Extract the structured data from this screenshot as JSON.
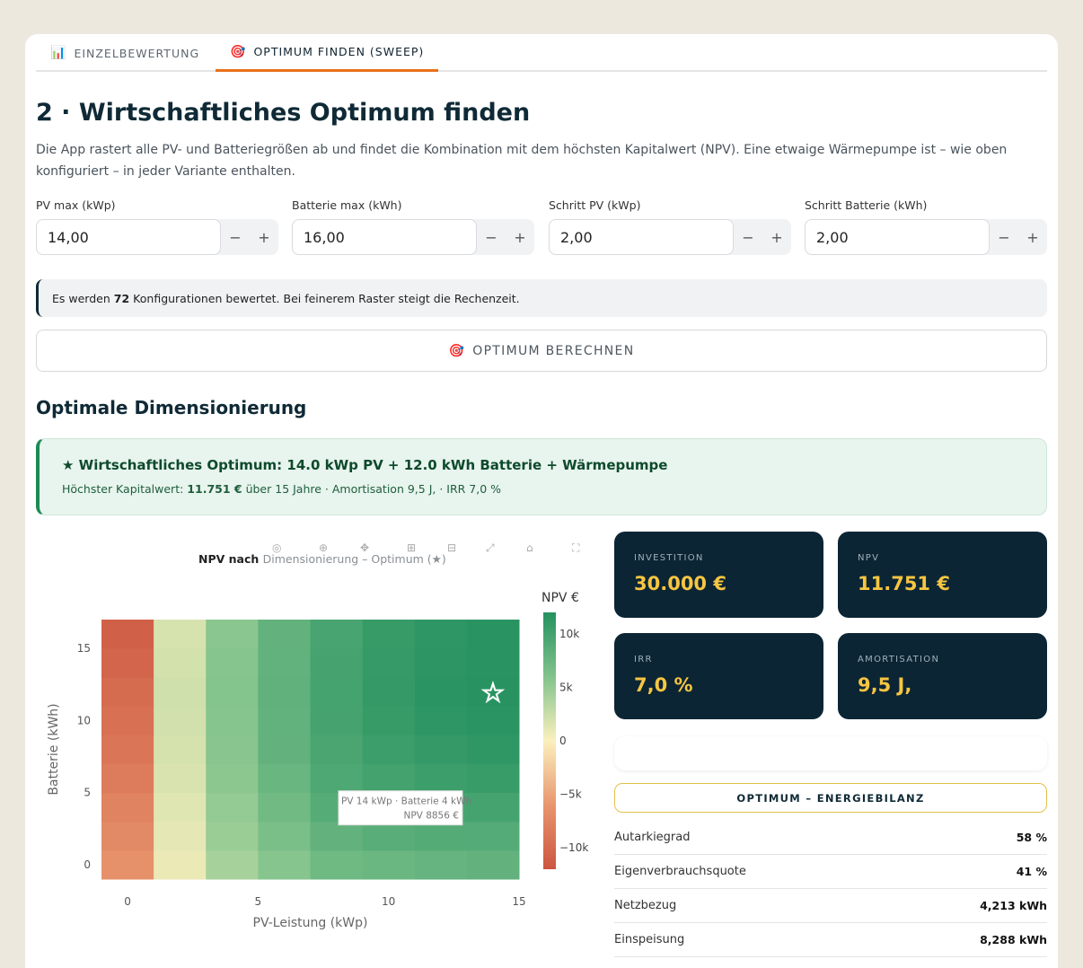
{
  "tabs": [
    {
      "label": "EINZELBEWERTUNG",
      "icon": "📊"
    },
    {
      "label": "OPTIMUM FINDEN (SWEEP)",
      "icon": "🎯"
    }
  ],
  "heading": "2 · Wirtschaftliches Optimum finden",
  "description": "Die App rastert alle PV- und Batteriegrößen ab und findet die Kombination mit dem höchsten Kapitalwert (NPV). Eine etwaige Wärmepumpe ist – wie oben konfiguriert – in jeder Variante enthalten.",
  "inputs": [
    {
      "label": "PV max (kWp)",
      "value": "14,00"
    },
    {
      "label": "Batterie max (kWh)",
      "value": "16,00"
    },
    {
      "label": "Schritt PV (kWp)",
      "value": "2,00"
    },
    {
      "label": "Schritt Batterie (kWh)",
      "value": "2,00"
    }
  ],
  "stepper": {
    "minus": "−",
    "plus": "+"
  },
  "info": {
    "pre": "Es werden",
    "count": "72",
    "post": "Konfigurationen bewertet. Bei feinerem Raster steigt die Rechenzeit."
  },
  "calc_button": {
    "label": "OPTIMUM BERECHNEN",
    "icon": "🎯"
  },
  "section_title": "Optimale Dimensionierung",
  "success": {
    "title": "★ Wirtschaftliches Optimum: 14.0 kWp PV + 12.0 kWh Batterie + Wärmepumpe",
    "sub_pre": "Höchster Kapitalwert:",
    "sub_value": "11.751 €",
    "sub_post": "über 15 Jahre · Amortisation 9,5 J, · IRR 7,0 %"
  },
  "kpis": [
    {
      "label": "INVESTITION",
      "value": "30.000 €"
    },
    {
      "label": "NPV",
      "value": "11.751 €"
    },
    {
      "label": "IRR",
      "value": "7,0 %"
    },
    {
      "label": "AMORTISATION",
      "value": "9,5 J,"
    }
  ],
  "energy_title": "OPTIMUM – ENERGIEBILANZ",
  "energy_rows": [
    {
      "label": "Autarkiegrad",
      "value": "58 %"
    },
    {
      "label": "Eigenverbrauchsquote",
      "value": "41 %"
    },
    {
      "label": "Netzbezug",
      "value": "4,213 kWh"
    },
    {
      "label": "Einspeisung",
      "value": "8,288 kWh"
    }
  ],
  "chart_data": {
    "type": "heatmap",
    "title_bold": "NPV nach",
    "title_rest": "Dimensionierung – Optimum (★)",
    "xlabel": "PV-Leistung (kWp)",
    "ylabel": "Batterie (kWh)",
    "x": [
      0,
      2,
      4,
      6,
      8,
      10,
      12,
      14
    ],
    "y": [
      0,
      2,
      4,
      6,
      8,
      10,
      12,
      14,
      16
    ],
    "x_ticks": [
      0,
      5,
      10,
      15
    ],
    "y_ticks": [
      0,
      5,
      10,
      15
    ],
    "xlim": [
      -1,
      15
    ],
    "ylim": [
      -1,
      17
    ],
    "colorbar_title": "NPV €",
    "colorbar_ticks": [
      "10k",
      "5k",
      "0",
      "−5k",
      "−10k"
    ],
    "colorbar_range": [
      -12000,
      12000
    ],
    "z": [
      [
        -6500,
        800,
        4200,
        5800,
        7200,
        7500,
        7800,
        8000
      ],
      [
        -7200,
        1100,
        4800,
        6500,
        8000,
        8700,
        8900,
        8856
      ],
      [
        -7800,
        1400,
        5100,
        7100,
        8800,
        9300,
        9700,
        9900
      ],
      [
        -8400,
        1700,
        5500,
        7600,
        9300,
        10000,
        10500,
        10700
      ],
      [
        -9000,
        1900,
        5700,
        8000,
        9600,
        10500,
        11000,
        11300
      ],
      [
        -9500,
        2100,
        5800,
        8100,
        9800,
        10800,
        11400,
        11600
      ],
      [
        -10000,
        2200,
        5900,
        8200,
        9900,
        11000,
        11600,
        11751
      ],
      [
        -10500,
        2000,
        5800,
        8100,
        9800,
        10900,
        11500,
        11700
      ],
      [
        -11000,
        1800,
        5600,
        8000,
        9700,
        10800,
        11400,
        11650
      ]
    ],
    "optimum": {
      "x": 14,
      "y": 12
    },
    "tooltip": {
      "line1": "PV 14 kWp · Batterie 4 kWh",
      "line2": "NPV 8856 €"
    }
  }
}
